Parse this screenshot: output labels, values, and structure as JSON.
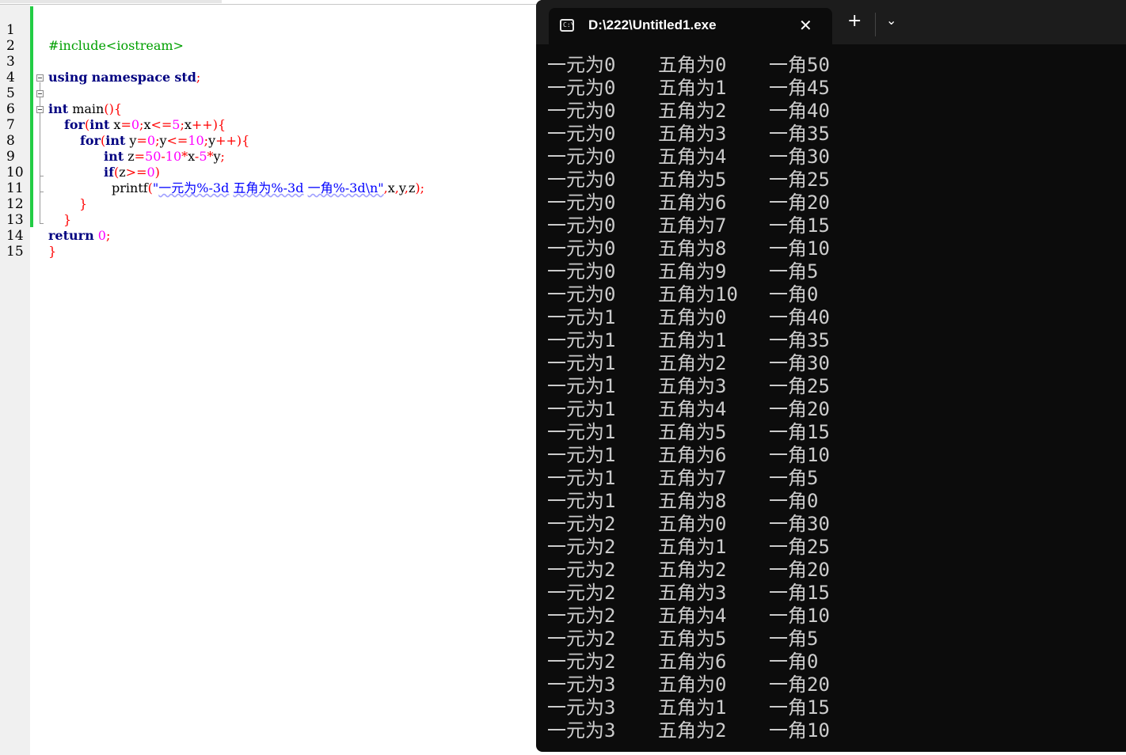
{
  "editor": {
    "line_numbers": [
      "1",
      "2",
      "3",
      "4",
      "5",
      "6",
      "7",
      "8",
      "9",
      "10",
      "11",
      "12",
      "13",
      "14",
      "15"
    ],
    "code": {
      "l1_include": "#include<iostream>",
      "l3_using": "using",
      "l3_namespace": "namespace",
      "l3_std": "std",
      "l3_semi": ";",
      "l5_int": "int",
      "l5_main": " main",
      "l5_paren": "(){",
      "l6_for": "for",
      "l6_open": "(",
      "l6_int": "int",
      "l6_x": " x",
      "l6_eq": "=",
      "l6_0": "0",
      "l6_s1": ";",
      "l6_x2": "x",
      "l6_le": "<=",
      "l6_5": "5",
      "l6_s2": ";",
      "l6_x3": "x",
      "l6_inc": "++){",
      "l7_for": "for",
      "l7_open": "(",
      "l7_int": "int",
      "l7_y": " y",
      "l7_eq": "=",
      "l7_0": "0",
      "l7_s1": ";",
      "l7_y2": "y",
      "l7_le": "<=",
      "l7_10": "10",
      "l7_s2": ";",
      "l7_y3": "y",
      "l7_inc": "++){",
      "l8_int": "int",
      "l8_z": " z",
      "l8_eq": "=",
      "l8_50": "50",
      "l8_minus1": "-",
      "l8_10": "10",
      "l8_mul1": "*",
      "l8_x": "x",
      "l8_minus2": "-",
      "l8_5": "5",
      "l8_mul2": "*",
      "l8_y": "y",
      "l8_semi": ";",
      "l9_if": "if",
      "l9_open": "(",
      "l9_z": "z",
      "l9_ge": ">=",
      "l9_0": "0",
      "l9_close": ")",
      "l10_printf": "printf",
      "l10_open": "(",
      "l10_q": "\"",
      "l10_s1": "一元为%-3d",
      "l10_sp1": " ",
      "l10_s2": "五角为%-3d",
      "l10_sp2": " ",
      "l10_s3": "一角%-3d\\n\"",
      "l10_c1": ",",
      "l10_x": "x",
      "l10_c2": ",",
      "l10_y": "y",
      "l10_c3": ",",
      "l10_z": "z",
      "l10_end": ");",
      "l11_brace": "}",
      "l12_brace": "}",
      "l13_return": "return",
      "l13_0": " 0",
      "l13_semi": ";",
      "l14_brace": "}"
    }
  },
  "terminal": {
    "tab_title": "D:\\222\\Untitled1.exe",
    "tab_icon_glyph": "C:\\",
    "close_glyph": "✕",
    "new_tab_glyph": "+",
    "dropdown_glyph": "⌄",
    "rows": [
      [
        "一元为0",
        "五角为0",
        "一角50"
      ],
      [
        "一元为0",
        "五角为1",
        "一角45"
      ],
      [
        "一元为0",
        "五角为2",
        "一角40"
      ],
      [
        "一元为0",
        "五角为3",
        "一角35"
      ],
      [
        "一元为0",
        "五角为4",
        "一角30"
      ],
      [
        "一元为0",
        "五角为5",
        "一角25"
      ],
      [
        "一元为0",
        "五角为6",
        "一角20"
      ],
      [
        "一元为0",
        "五角为7",
        "一角15"
      ],
      [
        "一元为0",
        "五角为8",
        "一角10"
      ],
      [
        "一元为0",
        "五角为9",
        "一角5"
      ],
      [
        "一元为0",
        "五角为10",
        "一角0"
      ],
      [
        "一元为1",
        "五角为0",
        "一角40"
      ],
      [
        "一元为1",
        "五角为1",
        "一角35"
      ],
      [
        "一元为1",
        "五角为2",
        "一角30"
      ],
      [
        "一元为1",
        "五角为3",
        "一角25"
      ],
      [
        "一元为1",
        "五角为4",
        "一角20"
      ],
      [
        "一元为1",
        "五角为5",
        "一角15"
      ],
      [
        "一元为1",
        "五角为6",
        "一角10"
      ],
      [
        "一元为1",
        "五角为7",
        "一角5"
      ],
      [
        "一元为1",
        "五角为8",
        "一角0"
      ],
      [
        "一元为2",
        "五角为0",
        "一角30"
      ],
      [
        "一元为2",
        "五角为1",
        "一角25"
      ],
      [
        "一元为2",
        "五角为2",
        "一角20"
      ],
      [
        "一元为2",
        "五角为3",
        "一角15"
      ],
      [
        "一元为2",
        "五角为4",
        "一角10"
      ],
      [
        "一元为2",
        "五角为5",
        "一角5"
      ],
      [
        "一元为2",
        "五角为6",
        "一角0"
      ],
      [
        "一元为3",
        "五角为0",
        "一角20"
      ],
      [
        "一元为3",
        "五角为1",
        "一角15"
      ],
      [
        "一元为3",
        "五角为2",
        "一角10"
      ]
    ]
  }
}
